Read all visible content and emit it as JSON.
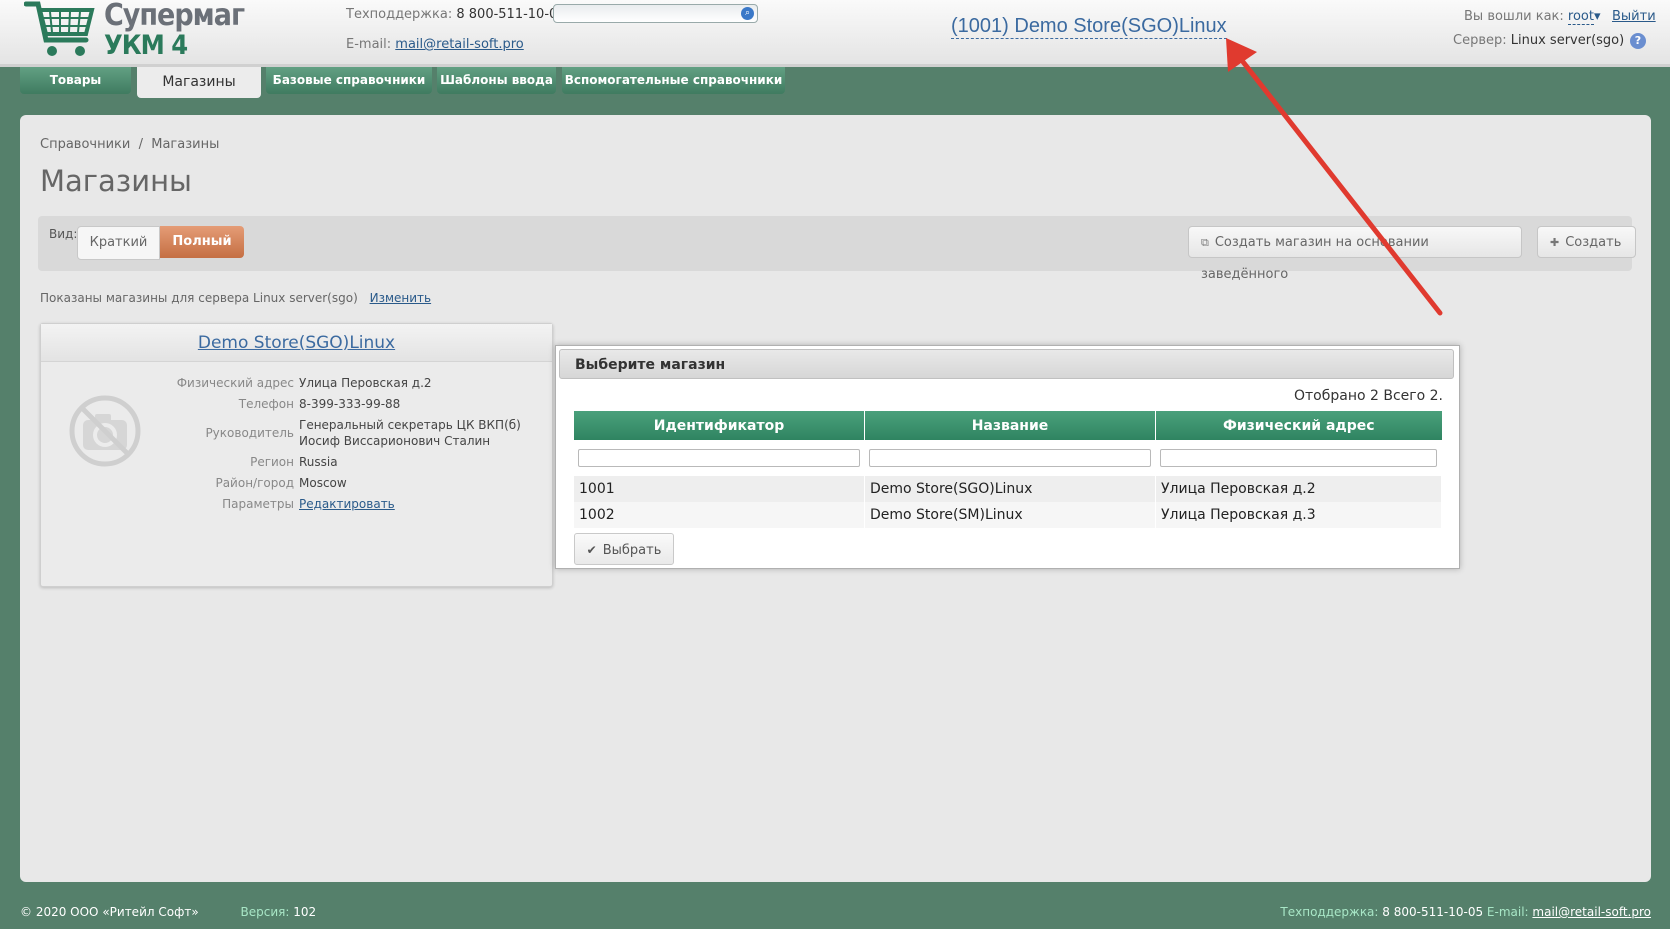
{
  "header": {
    "logo_line1": "Супермаг",
    "logo_line2": "УКМ 4",
    "support_label": "Техподдержка:",
    "support_phone": "8 800-511-10-05",
    "email_label": "E-mail:",
    "email": "mail@retail-soft.pro",
    "search": {
      "value": "",
      "placeholder": ""
    },
    "store_title": "(1001) Demo Store(SGO)Linux",
    "login_label": "Вы вошли как:",
    "user": "root",
    "user_caret": "▾",
    "logout": "Выйти",
    "server_label": "Сервер:",
    "server": "Linux server(sgo)",
    "help": "?"
  },
  "nav": {
    "tabs": [
      {
        "label": "Товары"
      },
      {
        "label": "Магазины"
      },
      {
        "label": "Базовые справочники"
      },
      {
        "label": "Шаблоны ввода"
      },
      {
        "label": "Вспомогательные справочники"
      }
    ]
  },
  "main": {
    "breadcrumb": "Справочники  /  Магазины",
    "title": "Магазины",
    "view_label": "Вид:",
    "view_short": "Краткий",
    "view_full": "Полный",
    "create_based": "Создать магазин на основании заведённого",
    "create": "Создать",
    "info": "Показаны магазины для сервера Linux server(sgo)",
    "change": "Изменить"
  },
  "store_card": {
    "name": "Demo Store(SGO)Linux",
    "props": [
      {
        "label": "Физический адрес",
        "value": "Улица Перовская д.2"
      },
      {
        "label": "Телефон",
        "value": "8-399-333-99-88"
      },
      {
        "label": "Руководитель",
        "value": "Генеральный секретарь ЦК ВКП(б)",
        "value2": "Иосиф Виссарионович Сталин"
      },
      {
        "label": "Регион",
        "value": "Russia"
      },
      {
        "label": "Район/город",
        "value": "Moscow"
      },
      {
        "label": "Параметры",
        "value": "Редактировать"
      }
    ]
  },
  "dialog": {
    "title": "Выберите магазин",
    "count": "Отобрано 2 Всего 2.",
    "columns": [
      "Идентификатор",
      "Название",
      "Физический адрес"
    ],
    "rows": [
      [
        "1001",
        "Demo Store(SGO)Linux",
        "Улица Перовская д.2"
      ],
      [
        "1002",
        "Demo Store(SM)Linux",
        "Улица Перовская д.3"
      ]
    ],
    "select": "Выбрать"
  },
  "footer": {
    "copyright": "© 2020 ООО «Ритейл Софт»",
    "version_label": "Версия:",
    "version": "102",
    "support_label": "Техподдержка:",
    "support_phone": "8 800-511-10-05",
    "email_label": "E-mail:",
    "email": "mail@retail-soft.pro"
  },
  "colors": {
    "brand_green": "#2f8461",
    "accent_orange": "#d98558",
    "arrow_red": "#e03a2f",
    "link": "#3b6aa0"
  }
}
